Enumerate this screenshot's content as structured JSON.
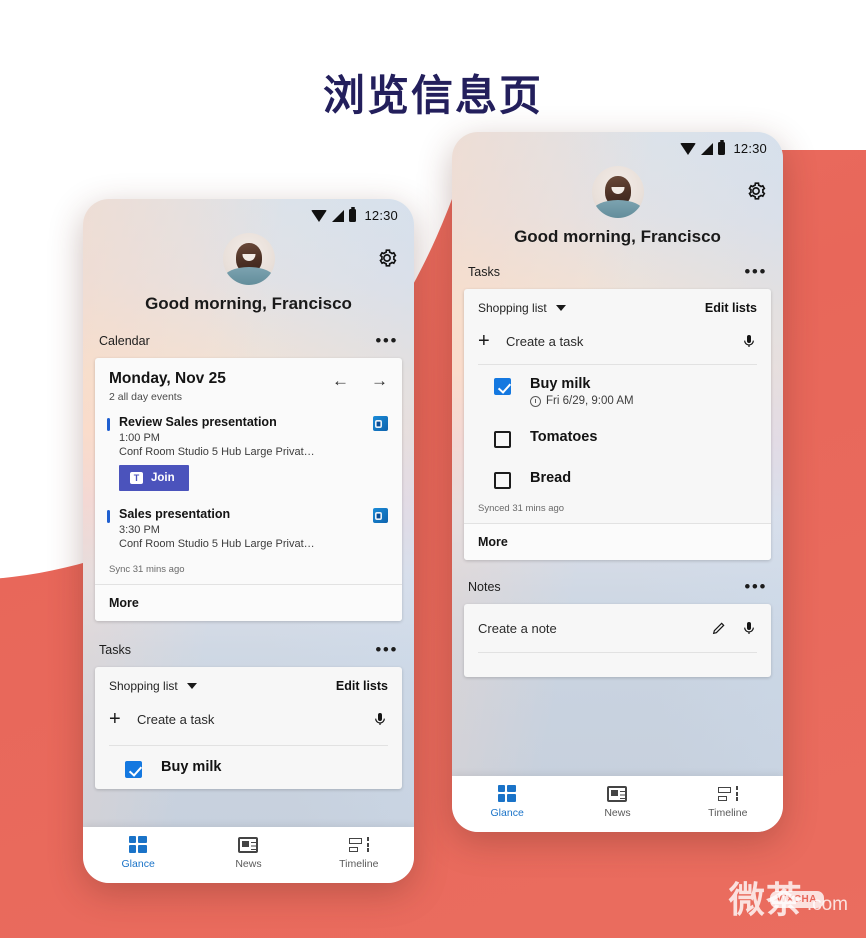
{
  "page": {
    "title": "浏览信息页",
    "title_color": "#231f5c",
    "background_color": "#e8675a"
  },
  "watermark": {
    "cn": "微茶",
    "badge": "WXCHA",
    "domain": ".com"
  },
  "status_bar": {
    "time": "12:30",
    "wifi": "wifi-icon",
    "signal": "signal-icon",
    "battery": "battery-icon"
  },
  "header": {
    "greeting": "Good morning, Francisco",
    "settings_icon": "gear-icon",
    "avatar": "user-avatar"
  },
  "calendar": {
    "section_label": "Calendar",
    "overflow": "•••",
    "date": "Monday, Nov 25",
    "subtitle": "2 all day events",
    "prev": "←",
    "next": "→",
    "events": [
      {
        "title": "Review Sales presentation",
        "time": "1:00 PM",
        "location": "Conf Room Studio 5 Hub Large Privat…",
        "source_icon": "outlook-icon",
        "action": {
          "label": "Join",
          "icon": "teams-icon",
          "color": "#4b53bc"
        }
      },
      {
        "title": "Sales presentation",
        "time": "3:30 PM",
        "location": "Conf Room Studio 5 Hub Large Privat…",
        "source_icon": "outlook-icon"
      }
    ],
    "sync": "Sync 31 mins ago",
    "more": "More"
  },
  "tasks": {
    "section_label": "Tasks",
    "overflow": "•••",
    "list_name": "Shopping list",
    "edit_lists": "Edit lists",
    "create_placeholder": "Create a task",
    "mic_icon": "microphone-icon",
    "items": [
      {
        "label": "Buy milk",
        "checked": true,
        "due": "Fri 6/29, 9:00 AM",
        "due_icon": "alarm-icon"
      },
      {
        "label": "Tomatoes",
        "checked": false,
        "due": ""
      },
      {
        "label": "Bread",
        "checked": false,
        "due": ""
      }
    ],
    "sync": "Synced 31 mins ago",
    "more": "More"
  },
  "notes": {
    "section_label": "Notes",
    "overflow": "•••",
    "create_placeholder": "Create a note",
    "pencil_icon": "pencil-icon",
    "mic_icon": "microphone-icon"
  },
  "bottom_nav": {
    "active": "Glance",
    "active_color": "#1a73c8",
    "items": [
      {
        "label": "Glance",
        "icon": "glance-icon"
      },
      {
        "label": "News",
        "icon": "news-icon"
      },
      {
        "label": "Timeline",
        "icon": "timeline-icon"
      }
    ]
  }
}
